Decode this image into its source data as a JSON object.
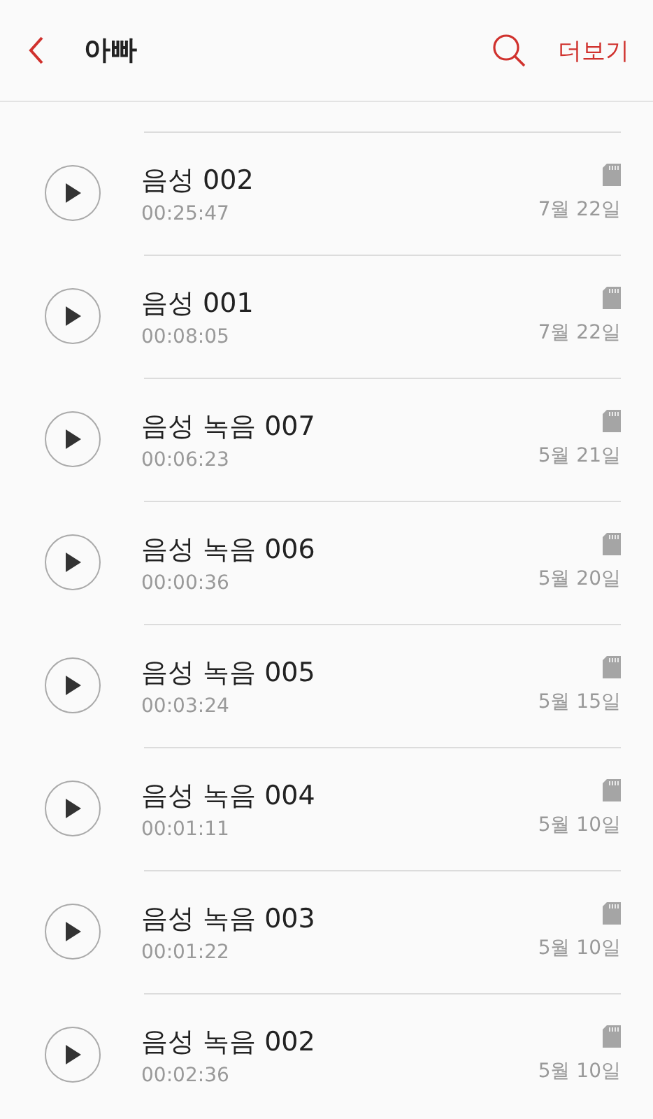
{
  "header": {
    "title": "아빠",
    "more": "더보기"
  },
  "recordings": [
    {
      "name": "음성 002",
      "duration": "00:25:47",
      "date": "7월 22일"
    },
    {
      "name": "음성 001",
      "duration": "00:08:05",
      "date": "7월 22일"
    },
    {
      "name": "음성 녹음 007",
      "duration": "00:06:23",
      "date": "5월 21일"
    },
    {
      "name": "음성 녹음 006",
      "duration": "00:00:36",
      "date": "5월 20일"
    },
    {
      "name": "음성 녹음 005",
      "duration": "00:03:24",
      "date": "5월 15일"
    },
    {
      "name": "음성 녹음 004",
      "duration": "00:01:11",
      "date": "5월 10일"
    },
    {
      "name": "음성 녹음 003",
      "duration": "00:01:22",
      "date": "5월 10일"
    },
    {
      "name": "음성 녹음 002",
      "duration": "00:02:36",
      "date": "5월 10일"
    }
  ]
}
